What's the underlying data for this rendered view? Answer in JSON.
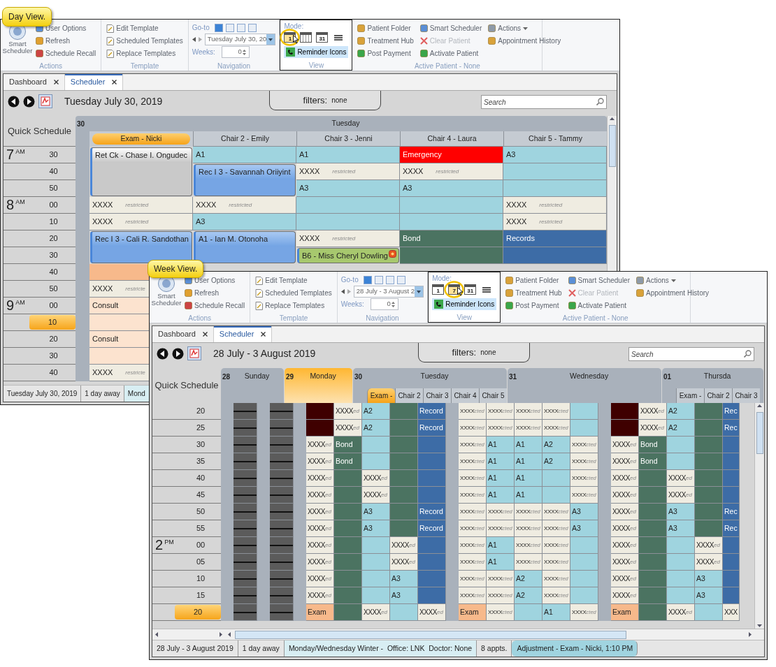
{
  "day_window": {
    "callout": "Day View.",
    "ribbon": {
      "actions": {
        "big": "Smart Scheduler",
        "items": [
          "User Options",
          "Refresh",
          "Schedule Recall"
        ],
        "label": "Actions"
      },
      "template": {
        "items": [
          "Edit Template",
          "Scheduled Templates",
          "Replace Templates"
        ],
        "label": "Template"
      },
      "navigation": {
        "goto": "Go-to",
        "date": "Tuesday July 30, 20",
        "weeks_label": "Weeks:",
        "weeks": "0",
        "label": "Navigation"
      },
      "view": {
        "mode_label": "Mode:",
        "modes": [
          {
            "kind": "calendar",
            "label": "1",
            "selected": true
          },
          {
            "kind": "calendar",
            "selected": false
          },
          {
            "kind": "calendar",
            "label": "31",
            "selected": false
          },
          {
            "kind": "list",
            "selected": false
          }
        ],
        "reminder": {
          "label": "Reminder Icons",
          "on": true
        },
        "label": "View"
      },
      "active_patient": {
        "items": [
          {
            "label": "Patient Folder",
            "disabled": false,
            "dropdown": false
          },
          {
            "label": "Treatment Hub",
            "disabled": false,
            "dropdown": false
          },
          {
            "label": "Post Payment",
            "disabled": false,
            "dropdown": false
          },
          {
            "label": "Smart Scheduler",
            "disabled": false,
            "dropdown": false
          },
          {
            "label": "Clear Patient",
            "disabled": true,
            "dropdown": false
          },
          {
            "label": "Activate Patient",
            "disabled": false,
            "dropdown": false
          },
          {
            "label": "Actions",
            "disabled": false,
            "dropdown": true
          },
          {
            "label": "Appointment History",
            "disabled": false,
            "dropdown": false
          }
        ],
        "label": "Active Patient - None"
      }
    },
    "tabs": [
      {
        "label": "Dashboard",
        "selected": false
      },
      {
        "label": "Scheduler",
        "selected": true
      }
    ],
    "date_title": "Tuesday July 30, 2019",
    "filters": {
      "label": "filters:",
      "value": "none"
    },
    "search": {
      "placeholder": "Search"
    },
    "quick_schedule": "Quick Schedule",
    "day": {
      "number": "30",
      "name": "Tuesday"
    },
    "time_rows": [
      {
        "hour": "7",
        "period": "AM",
        "minute": "30",
        "selected": false
      },
      {
        "minute": "40",
        "selected": false
      },
      {
        "minute": "50",
        "selected": false
      },
      {
        "hour": "8",
        "period": "AM",
        "minute": "00",
        "selected": false
      },
      {
        "minute": "10",
        "selected": false
      },
      {
        "minute": "20",
        "selected": false
      },
      {
        "minute": "30",
        "selected": false
      },
      {
        "minute": "40",
        "selected": false
      },
      {
        "minute": "50",
        "selected": false
      },
      {
        "hour": "9",
        "period": "AM",
        "minute": "00",
        "selected": false
      },
      {
        "minute": "10",
        "selected": true
      },
      {
        "minute": "20",
        "selected": false
      },
      {
        "minute": "30",
        "selected": false
      },
      {
        "minute": "40",
        "selected": false
      }
    ],
    "columns": [
      {
        "name": "Exam - Nicki",
        "selected": true,
        "cells": [
          {
            "kind": "card",
            "text": "Ret Ck - Chase I. Ongudec",
            "extends": false
          },
          {
            "kind": "card",
            "extends": true
          },
          {
            "kind": "card",
            "extends": true
          },
          {
            "kind": "restricted",
            "text": "XXXX",
            "note": "restricted",
            "extends": false
          },
          {
            "kind": "restricted",
            "text": "XXXX",
            "note": "restricted",
            "extends": false
          },
          {
            "kind": "booking",
            "text": "Rec I 3 - Cali R. Sandothan",
            "extends": false
          },
          {
            "kind": "booking",
            "extends": true
          },
          {
            "kind": "exam",
            "extends": false
          },
          {
            "kind": "restricted",
            "text": "XXXX",
            "note": "restricte",
            "extends": false
          },
          {
            "kind": "consult",
            "text": "Consult",
            "extends": false
          },
          {
            "kind": "consult",
            "extends": false
          },
          {
            "kind": "consult",
            "text": "Consult",
            "extends": false
          },
          {
            "kind": "consult",
            "extends": false
          },
          {
            "kind": "restricted",
            "text": "XXXX",
            "note": "restricte",
            "extends": false
          }
        ]
      },
      {
        "name": "Chair 2 - Emily",
        "selected": false,
        "cells": [
          {
            "kind": "open",
            "text": "A1",
            "extends": false
          },
          {
            "kind": "booking",
            "text": "Rec I 3 - Savannah Oriiyint",
            "extends": false
          },
          {
            "kind": "booking",
            "extends": true
          },
          {
            "kind": "restricted",
            "text": "XXXX",
            "note": "restricted",
            "extends": false
          },
          {
            "kind": "open",
            "text": "A3",
            "extends": false
          },
          {
            "kind": "booking",
            "text": "A1 - Ian M. Otonoha",
            "extends": false
          },
          {
            "kind": "booking",
            "extends": true
          }
        ]
      },
      {
        "name": "Chair 3 - Jenni",
        "selected": false,
        "cells": [
          {
            "kind": "open",
            "text": "A1",
            "extends": false
          },
          {
            "kind": "restricted",
            "text": "XXXX",
            "note": "restricted",
            "extends": false
          },
          {
            "kind": "open",
            "text": "A3",
            "extends": false
          },
          {
            "kind": "open",
            "extends": false
          },
          {
            "kind": "open",
            "extends": false
          },
          {
            "kind": "restricted",
            "text": "XXXX",
            "note": "restricted",
            "extends": false
          },
          {
            "kind": "procedure",
            "text": "B6 - Miss Cheryl Dowling",
            "alert": true,
            "extends": false
          }
        ]
      },
      {
        "name": "Chair 4 - Laura",
        "selected": false,
        "cells": [
          {
            "kind": "emergency",
            "text": "Emergency",
            "extends": false
          },
          {
            "kind": "restricted",
            "text": "XXXX",
            "note": "restricted",
            "extends": false
          },
          {
            "kind": "open",
            "text": "A3",
            "extends": false
          },
          {
            "kind": "open",
            "extends": false
          },
          {
            "kind": "open",
            "extends": false
          },
          {
            "kind": "green",
            "text": "Bond",
            "extends": false
          },
          {
            "kind": "green",
            "extends": false
          }
        ]
      },
      {
        "name": "Chair 5 - Tammy",
        "selected": false,
        "cells": [
          {
            "kind": "open",
            "text": "A3",
            "extends": false
          },
          {
            "kind": "open",
            "extends": false
          },
          {
            "kind": "open",
            "extends": false
          },
          {
            "kind": "restricted",
            "text": "XXXX",
            "note": "restricted",
            "extends": false
          },
          {
            "kind": "restricted",
            "text": "XXXX",
            "note": "restricted",
            "extends": false
          },
          {
            "kind": "records",
            "text": "Records",
            "extends": false
          },
          {
            "kind": "records",
            "extends": false
          }
        ]
      }
    ],
    "status_bar": [
      {
        "text": "Tuesday July 30, 2019",
        "kind": "plain"
      },
      {
        "text": "1 day away",
        "kind": "plain"
      },
      {
        "text": "Mond",
        "kind": "template"
      }
    ]
  },
  "week_window": {
    "callout": "Week View.",
    "ribbon": {
      "actions": {
        "big": "Smart Scheduler",
        "items": [
          "User Options",
          "Refresh",
          "Schedule Recall"
        ],
        "label": "Actions"
      },
      "template": {
        "items": [
          "Edit Template",
          "Scheduled Templates",
          "Replace Templates"
        ],
        "label": "Template"
      },
      "navigation": {
        "goto": "Go-to",
        "date": "28 July - 3 August 2",
        "weeks_label": "Weeks:",
        "weeks": "0",
        "label": "Navigation"
      },
      "view": {
        "mode_label": "Mode:",
        "modes": [
          {
            "kind": "calendar",
            "label": "1",
            "selected": false
          },
          {
            "kind": "calendar",
            "label": "7",
            "selected": true
          },
          {
            "kind": "calendar",
            "label": "31",
            "selected": false
          },
          {
            "kind": "list",
            "selected": false
          }
        ],
        "reminder": {
          "label": "Reminder Icons",
          "on": true
        },
        "label": "View"
      },
      "active_patient": {
        "items": [
          {
            "label": "Patient Folder",
            "disabled": false,
            "dropdown": false
          },
          {
            "label": "Treatment Hub",
            "disabled": false,
            "dropdown": false
          },
          {
            "label": "Post Payment",
            "disabled": false,
            "dropdown": false
          },
          {
            "label": "Smart Scheduler",
            "disabled": false,
            "dropdown": false
          },
          {
            "label": "Clear Patient",
            "disabled": true,
            "dropdown": false
          },
          {
            "label": "Activate Patient",
            "disabled": false,
            "dropdown": false
          },
          {
            "label": "Actions",
            "disabled": false,
            "dropdown": true
          },
          {
            "label": "Appointment History",
            "disabled": false,
            "dropdown": false
          }
        ],
        "label": "Active Patient - None"
      }
    },
    "tabs": [
      {
        "label": "Dashboard",
        "selected": false
      },
      {
        "label": "Scheduler",
        "selected": true
      }
    ],
    "date_title": "28 July - 3 August 2019",
    "filters": {
      "label": "filters:",
      "value": "none"
    },
    "search": {
      "placeholder": "Search"
    },
    "quick_schedule": "Quick Schedule",
    "days": [
      {
        "number": "28",
        "name": "Sunday",
        "selected": false
      },
      {
        "number": "29",
        "name": "Monday",
        "selected": true
      },
      {
        "number": "30",
        "name": "Tuesday",
        "selected": false,
        "chairs": [
          {
            "label": "Exam -",
            "selected": true
          },
          {
            "label": "Chair 2",
            "selected": false
          },
          {
            "label": "Chair 3",
            "selected": false
          },
          {
            "label": "Chair 4",
            "selected": false
          },
          {
            "label": "Chair 5",
            "selected": false
          }
        ]
      },
      {
        "number": "31",
        "name": "Wednesday",
        "selected": false
      },
      {
        "number": "01",
        "name": "Thursda",
        "selected": false,
        "chairs": [
          {
            "label": "Exam -",
            "selected": false
          },
          {
            "label": "Chair 2",
            "selected": false
          },
          {
            "label": "Chair 3",
            "selected": false
          }
        ]
      }
    ],
    "rows": [
      {
        "minute": "20",
        "selected": false,
        "cells": [
          {
            "kind": "closed"
          },
          {
            "kind": "closed"
          },
          {
            "kind": "blocked"
          },
          {
            "kind": "restricted",
            "text": "XXXX",
            "note": "ed"
          },
          {
            "kind": "open",
            "text": "A2"
          },
          {
            "kind": "green"
          },
          {
            "kind": "records",
            "text": "Record"
          },
          {
            "kind": "tight",
            "text": "XXXX",
            "note": "cted"
          },
          {
            "kind": "tight",
            "text": "XXXX",
            "note": "cted"
          },
          {
            "kind": "tight",
            "text": "XXXX",
            "note": "cted"
          },
          {
            "kind": "tight",
            "text": "XXXX",
            "note": "cted"
          },
          {
            "kind": "open"
          },
          {
            "kind": "blocked"
          },
          {
            "kind": "restricted",
            "text": "XXXX",
            "note": "ed"
          },
          {
            "kind": "open",
            "text": "A2"
          },
          {
            "kind": "green"
          },
          {
            "kind": "records",
            "text": "Rec"
          }
        ]
      },
      {
        "minute": "25",
        "selected": false,
        "cells": [
          {
            "kind": "closed"
          },
          {
            "kind": "closed"
          },
          {
            "kind": "blocked"
          },
          {
            "kind": "restricted",
            "text": "XXXX",
            "note": "ed"
          },
          {
            "kind": "open",
            "text": "A2"
          },
          {
            "kind": "green"
          },
          {
            "kind": "records",
            "text": "Record"
          },
          {
            "kind": "tight",
            "text": "XXXX",
            "note": "cted"
          },
          {
            "kind": "tight",
            "text": "XXXX",
            "note": "cted"
          },
          {
            "kind": "tight",
            "text": "XXXX",
            "note": "cted"
          },
          {
            "kind": "tight",
            "text": "XXXX",
            "note": "cted"
          },
          {
            "kind": "open"
          },
          {
            "kind": "blocked"
          },
          {
            "kind": "restricted",
            "text": "XXXX",
            "note": "ed"
          },
          {
            "kind": "open",
            "text": "A2"
          },
          {
            "kind": "green"
          },
          {
            "kind": "records",
            "text": "Rec"
          }
        ]
      },
      {
        "minute": "30",
        "selected": false,
        "cells": [
          {
            "kind": "closed"
          },
          {
            "kind": "closed"
          },
          {
            "kind": "restricted",
            "text": "XXXX",
            "note": "ed"
          },
          {
            "kind": "green",
            "text": "Bond"
          },
          {
            "kind": "open"
          },
          {
            "kind": "green"
          },
          {
            "kind": "records"
          },
          {
            "kind": "tight",
            "text": "XXXX",
            "note": "cted"
          },
          {
            "kind": "open",
            "text": "A1"
          },
          {
            "kind": "open",
            "text": "A1"
          },
          {
            "kind": "open",
            "text": "A2"
          },
          {
            "kind": "tight",
            "text": "XXXX",
            "note": "cted"
          },
          {
            "kind": "restricted",
            "text": "XXXX",
            "note": "ed"
          },
          {
            "kind": "green",
            "text": "Bond"
          },
          {
            "kind": "open"
          },
          {
            "kind": "green"
          },
          {
            "kind": "records"
          }
        ]
      },
      {
        "minute": "35",
        "selected": false,
        "cells": [
          {
            "kind": "closed"
          },
          {
            "kind": "closed"
          },
          {
            "kind": "restricted",
            "text": "XXXX",
            "note": "ed"
          },
          {
            "kind": "green",
            "text": "Bond"
          },
          {
            "kind": "open"
          },
          {
            "kind": "green"
          },
          {
            "kind": "records"
          },
          {
            "kind": "tight",
            "text": "XXXX",
            "note": "cted"
          },
          {
            "kind": "open",
            "text": "A1"
          },
          {
            "kind": "open",
            "text": "A1"
          },
          {
            "kind": "open",
            "text": "A2"
          },
          {
            "kind": "tight",
            "text": "XXXX",
            "note": "cted"
          },
          {
            "kind": "restricted",
            "text": "XXXX",
            "note": "ed"
          },
          {
            "kind": "green",
            "text": "Bond"
          },
          {
            "kind": "open"
          },
          {
            "kind": "green"
          },
          {
            "kind": "records"
          }
        ]
      },
      {
        "minute": "40",
        "selected": false,
        "cells": [
          {
            "kind": "closed"
          },
          {
            "kind": "closed"
          },
          {
            "kind": "restricted",
            "text": "XXXX",
            "note": "ed"
          },
          {
            "kind": "green"
          },
          {
            "kind": "restricted",
            "text": "XXXX",
            "note": "ed"
          },
          {
            "kind": "green"
          },
          {
            "kind": "records"
          },
          {
            "kind": "tight",
            "text": "XXXX",
            "note": "cted"
          },
          {
            "kind": "open",
            "text": "A1"
          },
          {
            "kind": "open",
            "text": "A1"
          },
          {
            "kind": "open"
          },
          {
            "kind": "tight",
            "text": "XXXX",
            "note": "cted"
          },
          {
            "kind": "restricted",
            "text": "XXXX",
            "note": "ed"
          },
          {
            "kind": "green"
          },
          {
            "kind": "restricted",
            "text": "XXXX",
            "note": "ed"
          },
          {
            "kind": "green"
          },
          {
            "kind": "records"
          }
        ]
      },
      {
        "minute": "45",
        "selected": false,
        "cells": [
          {
            "kind": "closed"
          },
          {
            "kind": "closed"
          },
          {
            "kind": "restricted",
            "text": "XXXX",
            "note": "ed"
          },
          {
            "kind": "green"
          },
          {
            "kind": "restricted",
            "text": "XXXX",
            "note": "ed"
          },
          {
            "kind": "green"
          },
          {
            "kind": "records"
          },
          {
            "kind": "tight",
            "text": "XXXX",
            "note": "cted"
          },
          {
            "kind": "open",
            "text": "A1"
          },
          {
            "kind": "open",
            "text": "A1"
          },
          {
            "kind": "open"
          },
          {
            "kind": "tight",
            "text": "XXXX",
            "note": "cted"
          },
          {
            "kind": "restricted",
            "text": "XXXX",
            "note": "ed"
          },
          {
            "kind": "green"
          },
          {
            "kind": "restricted",
            "text": "XXXX",
            "note": "ed"
          },
          {
            "kind": "green"
          },
          {
            "kind": "records"
          }
        ]
      },
      {
        "minute": "50",
        "selected": false,
        "cells": [
          {
            "kind": "closed"
          },
          {
            "kind": "closed"
          },
          {
            "kind": "restricted",
            "text": "XXXX",
            "note": "ed"
          },
          {
            "kind": "green"
          },
          {
            "kind": "open",
            "text": "A3"
          },
          {
            "kind": "green"
          },
          {
            "kind": "records",
            "text": "Record"
          },
          {
            "kind": "tight",
            "text": "XXXX",
            "note": "cted"
          },
          {
            "kind": "tight",
            "text": "XXXX",
            "note": "cted"
          },
          {
            "kind": "tight",
            "text": "XXXX",
            "note": "cted"
          },
          {
            "kind": "tight",
            "text": "XXXX",
            "note": "cted"
          },
          {
            "kind": "open",
            "text": "A3"
          },
          {
            "kind": "restricted",
            "text": "XXXX",
            "note": "ed"
          },
          {
            "kind": "green"
          },
          {
            "kind": "open",
            "text": "A3"
          },
          {
            "kind": "green"
          },
          {
            "kind": "records",
            "text": "Rec"
          }
        ]
      },
      {
        "minute": "55",
        "selected": false,
        "cells": [
          {
            "kind": "closed"
          },
          {
            "kind": "closed"
          },
          {
            "kind": "restricted",
            "text": "XXXX",
            "note": "ed"
          },
          {
            "kind": "green"
          },
          {
            "kind": "open",
            "text": "A3"
          },
          {
            "kind": "green"
          },
          {
            "kind": "records",
            "text": "Record"
          },
          {
            "kind": "tight",
            "text": "XXXX",
            "note": "cted"
          },
          {
            "kind": "tight",
            "text": "XXXX",
            "note": "cted"
          },
          {
            "kind": "tight",
            "text": "XXXX",
            "note": "cted"
          },
          {
            "kind": "tight",
            "text": "XXXX",
            "note": "cted"
          },
          {
            "kind": "open",
            "text": "A3"
          },
          {
            "kind": "restricted",
            "text": "XXXX",
            "note": "ed"
          },
          {
            "kind": "green"
          },
          {
            "kind": "open",
            "text": "A3"
          },
          {
            "kind": "green"
          },
          {
            "kind": "records",
            "text": "Rec"
          }
        ]
      },
      {
        "hour": "2",
        "period": "PM",
        "minute": "00",
        "selected": false,
        "cells": [
          {
            "kind": "closed"
          },
          {
            "kind": "closed"
          },
          {
            "kind": "restricted",
            "text": "XXXX",
            "note": "ed"
          },
          {
            "kind": "green"
          },
          {
            "kind": "open"
          },
          {
            "kind": "restricted",
            "text": "XXXX",
            "note": "ed"
          },
          {
            "kind": "records"
          },
          {
            "kind": "tight",
            "text": "XXXX",
            "note": "cted"
          },
          {
            "kind": "open",
            "text": "A1"
          },
          {
            "kind": "tight",
            "text": "XXXX",
            "note": "cted"
          },
          {
            "kind": "tight",
            "text": "XXXX",
            "note": "cted"
          },
          {
            "kind": "open"
          },
          {
            "kind": "restricted",
            "text": "XXXX",
            "note": "ed"
          },
          {
            "kind": "green"
          },
          {
            "kind": "open"
          },
          {
            "kind": "restricted",
            "text": "XXXX",
            "note": "ed"
          },
          {
            "kind": "records"
          }
        ]
      },
      {
        "minute": "05",
        "selected": false,
        "cells": [
          {
            "kind": "closed"
          },
          {
            "kind": "closed"
          },
          {
            "kind": "restricted",
            "text": "XXXX",
            "note": "ed"
          },
          {
            "kind": "green"
          },
          {
            "kind": "open"
          },
          {
            "kind": "restricted",
            "text": "XXXX",
            "note": "ed"
          },
          {
            "kind": "records"
          },
          {
            "kind": "tight",
            "text": "XXXX",
            "note": "cted"
          },
          {
            "kind": "open",
            "text": "A1"
          },
          {
            "kind": "tight",
            "text": "XXXX",
            "note": "cted"
          },
          {
            "kind": "tight",
            "text": "XXXX",
            "note": "cted"
          },
          {
            "kind": "open"
          },
          {
            "kind": "restricted",
            "text": "XXXX",
            "note": "ed"
          },
          {
            "kind": "green"
          },
          {
            "kind": "open"
          },
          {
            "kind": "restricted",
            "text": "XXXX",
            "note": "ed"
          },
          {
            "kind": "records"
          }
        ]
      },
      {
        "minute": "10",
        "selected": false,
        "cells": [
          {
            "kind": "closed"
          },
          {
            "kind": "closed"
          },
          {
            "kind": "restricted",
            "text": "XXXX",
            "note": "ed"
          },
          {
            "kind": "green"
          },
          {
            "kind": "open"
          },
          {
            "kind": "open",
            "text": "A3"
          },
          {
            "kind": "records"
          },
          {
            "kind": "tight",
            "text": "XXXX",
            "note": "cted"
          },
          {
            "kind": "tight",
            "text": "XXXX",
            "note": "cted"
          },
          {
            "kind": "open",
            "text": "A2"
          },
          {
            "kind": "tight",
            "text": "XXXX",
            "note": "cted"
          },
          {
            "kind": "open"
          },
          {
            "kind": "restricted",
            "text": "XXXX",
            "note": "ed"
          },
          {
            "kind": "green"
          },
          {
            "kind": "open"
          },
          {
            "kind": "open",
            "text": "A3"
          },
          {
            "kind": "records"
          }
        ]
      },
      {
        "minute": "15",
        "selected": false,
        "cells": [
          {
            "kind": "closed"
          },
          {
            "kind": "closed"
          },
          {
            "kind": "restricted",
            "text": "XXXX",
            "note": "ed"
          },
          {
            "kind": "green"
          },
          {
            "kind": "open"
          },
          {
            "kind": "open",
            "text": "A3"
          },
          {
            "kind": "records"
          },
          {
            "kind": "tight",
            "text": "XXXX",
            "note": "cted"
          },
          {
            "kind": "tight",
            "text": "XXXX",
            "note": "cted"
          },
          {
            "kind": "open",
            "text": "A2"
          },
          {
            "kind": "tight",
            "text": "XXXX",
            "note": "cted"
          },
          {
            "kind": "open"
          },
          {
            "kind": "restricted",
            "text": "XXXX",
            "note": "ed"
          },
          {
            "kind": "green"
          },
          {
            "kind": "open"
          },
          {
            "kind": "open",
            "text": "A3"
          },
          {
            "kind": "records"
          }
        ]
      },
      {
        "minute": "20",
        "selected": true,
        "cells": [
          {
            "kind": "closed"
          },
          {
            "kind": "closed"
          },
          {
            "kind": "exam",
            "text": "Exam"
          },
          {
            "kind": "green"
          },
          {
            "kind": "restricted",
            "text": "XXXX",
            "note": "ed"
          },
          {
            "kind": "open"
          },
          {
            "kind": "restricted",
            "text": "XXXX",
            "note": "ed"
          },
          {
            "kind": "exam",
            "text": "Exam"
          },
          {
            "kind": "tight",
            "text": "XXXX",
            "note": "cted"
          },
          {
            "kind": "open"
          },
          {
            "kind": "open",
            "text": "A1"
          },
          {
            "kind": "tight",
            "text": "XXXX",
            "note": "cted"
          },
          {
            "kind": "exam",
            "text": "Exam"
          },
          {
            "kind": "green"
          },
          {
            "kind": "restricted",
            "text": "XXXX",
            "note": "ed"
          },
          {
            "kind": "open"
          },
          {
            "kind": "restricted",
            "text": "XXX"
          }
        ]
      }
    ],
    "status_bar": [
      {
        "text": "28 July - 3 August 2019",
        "kind": "plain"
      },
      {
        "text": "1 day away",
        "kind": "plain"
      },
      {
        "text": "Monday/Wednesday Winter -  Office: LNK  Doctor: None",
        "kind": "template"
      },
      {
        "text": "8 appts.",
        "kind": "plain"
      },
      {
        "text": "Adjustment - Exam - Nicki, 1:10 PM",
        "kind": "alert"
      }
    ]
  }
}
